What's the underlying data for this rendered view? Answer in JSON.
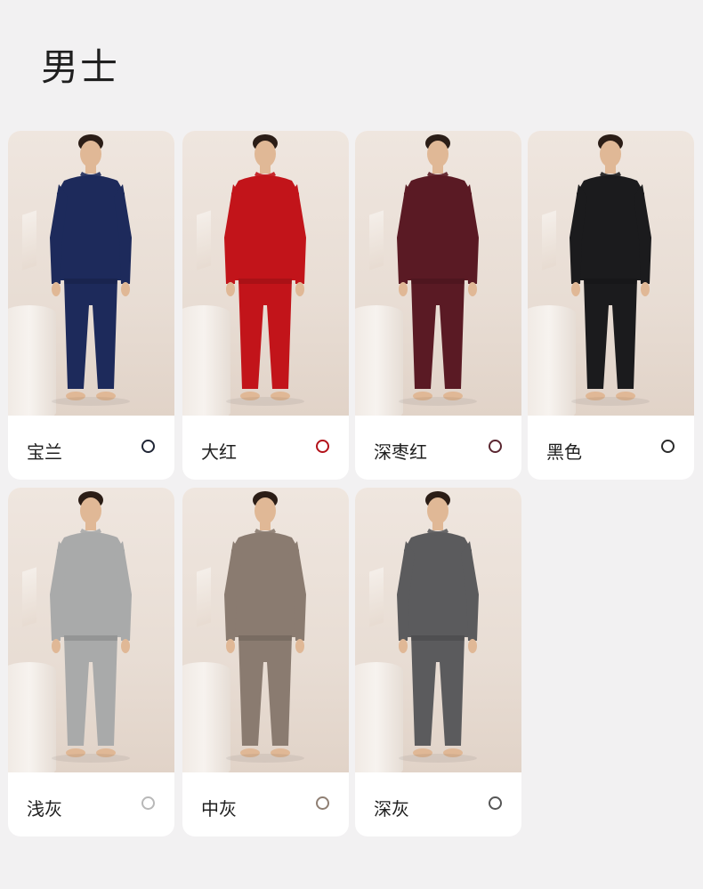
{
  "page": {
    "title": "男士"
  },
  "cards": [
    {
      "label": "宝兰",
      "color": "#1d2a5b",
      "dot": "#1f2535"
    },
    {
      "label": "大红",
      "color": "#c2141a",
      "dot": "#b3121a"
    },
    {
      "label": "深枣红",
      "color": "#5a1a24",
      "dot": "#5a2630"
    },
    {
      "label": "黑色",
      "color": "#1b1b1d",
      "dot": "#2a2a2a"
    },
    {
      "label": "浅灰",
      "color": "#a9aaaa",
      "dot": "#b8b8b8"
    },
    {
      "label": "中灰",
      "color": "#8a7b70",
      "dot": "#8f7f73"
    },
    {
      "label": "深灰",
      "color": "#5b5b5d",
      "dot": "#555555"
    }
  ]
}
